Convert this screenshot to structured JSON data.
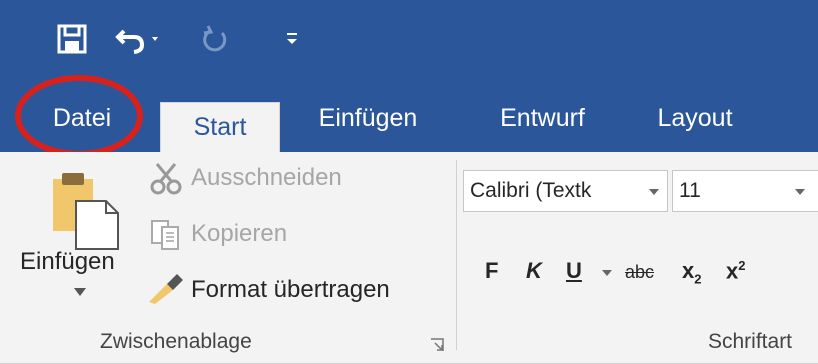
{
  "quick_access": {
    "save_icon": "save-icon",
    "undo_icon": "undo-icon",
    "redo_icon": "redo-icon",
    "customize_icon": "customize-qat-icon"
  },
  "tabs": {
    "datei": "Datei",
    "start": "Start",
    "einfuegen": "Einfügen",
    "entwurf": "Entwurf",
    "layout": "Layout"
  },
  "clipboard": {
    "paste_label": "Einfügen",
    "cut_label": "Ausschneiden",
    "copy_label": "Kopieren",
    "format_painter_label": "Format übertragen",
    "group_label": "Zwischenablage"
  },
  "font": {
    "font_name": "Calibri (Textk",
    "font_size": "11",
    "bold_label": "F",
    "italic_label": "K",
    "underline_label": "U",
    "strike_label": "abc",
    "subscript_label": "x",
    "subscript_sub": "2",
    "superscript_label": "x",
    "superscript_sup": "2",
    "group_label": "Schriftart"
  },
  "colors": {
    "ribbon_blue": "#2b579a",
    "ribbon_body": "#f3f3f3",
    "highlight_circle": "#d9211b"
  }
}
